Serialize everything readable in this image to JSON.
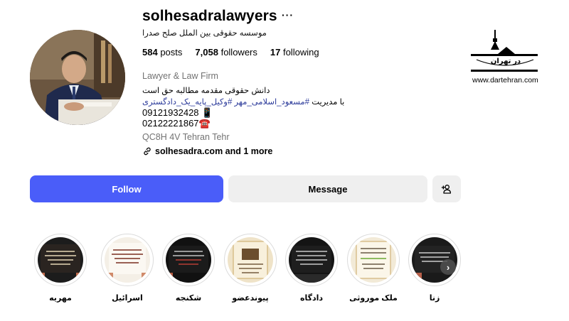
{
  "profile": {
    "username": "solhesadralawyers",
    "full_name": "موسسه حقوقی بین الملل صلح صدرا",
    "stats": {
      "posts": "584",
      "posts_label": "posts",
      "followers": "7,058",
      "followers_label": "followers",
      "following": "17",
      "following_label": "following"
    },
    "category": "Lawyer & Law Firm",
    "bio_line1": "دانش حقوقی مقدمه مطالبه حق است",
    "bio_line2_prefix": "با مدیریت",
    "bio_hashtag1": "#مسعود_اسلامی_مهر",
    "bio_hashtag2": "#وکیل_پایه_یک_دادگستری",
    "phone_mobile": "09121932428",
    "phone_mobile_emoji": "📱",
    "phone_office": "02122221867",
    "phone_office_emoji": "☎️",
    "address": "QC8H 4V Tehran Tehr",
    "links_text": "solhesadra.com and 1 more"
  },
  "actions": {
    "follow_label": "Follow",
    "message_label": "Message"
  },
  "highlights": [
    {
      "label": "مهریه"
    },
    {
      "label": "اسرائیل"
    },
    {
      "label": "شکنجه"
    },
    {
      "label": "پیوندعضو"
    },
    {
      "label": "دادگاه"
    },
    {
      "label": "ملک موروثی"
    },
    {
      "label": "زنا"
    }
  ],
  "watermark": {
    "logo_text": "در تهران",
    "url": "www.dartehran.com"
  },
  "colors": {
    "follow_button": "#4a5df9",
    "secondary_button": "#efefef",
    "hashtag": "#2b3a9a",
    "muted_text": "#737373"
  }
}
